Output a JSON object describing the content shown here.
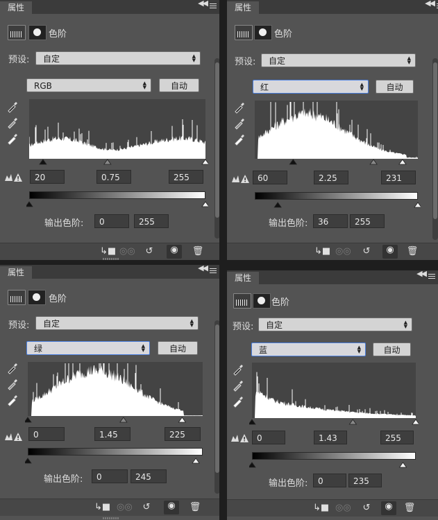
{
  "panels": [
    {
      "id": "rgb",
      "tab": "属性",
      "title": "色阶",
      "preset_label": "预设:",
      "preset_value": "自定",
      "channel": "RGB",
      "auto_label": "自动",
      "input_black": "20",
      "input_gamma": "0.75",
      "input_white": "255",
      "output_label": "输出色阶:",
      "output_black": "0",
      "output_white": "255",
      "histogram_shape": "flat-rgb",
      "input_levels": {
        "black": 20,
        "gamma": 0.75,
        "white": 255
      },
      "output_levels": {
        "black": 0,
        "white": 255
      }
    },
    {
      "id": "red",
      "tab": "属性",
      "title": "色阶",
      "preset_label": "预设:",
      "preset_value": "自定",
      "channel": "红",
      "auto_label": "自动",
      "input_black": "60",
      "input_gamma": "2.25",
      "input_white": "231",
      "output_label": "输出色阶:",
      "output_black": "36",
      "output_white": "255",
      "histogram_shape": "hump-red",
      "input_levels": {
        "black": 60,
        "gamma": 2.25,
        "white": 231
      },
      "output_levels": {
        "black": 36,
        "white": 255
      }
    },
    {
      "id": "green",
      "tab": "属性",
      "title": "色阶",
      "preset_label": "预设:",
      "preset_value": "自定",
      "channel": "绿",
      "auto_label": "自动",
      "input_black": "0",
      "input_gamma": "1.45",
      "input_white": "225",
      "output_label": "输出色阶:",
      "output_black": "0",
      "output_white": "245",
      "histogram_shape": "hump-green",
      "input_levels": {
        "black": 0,
        "gamma": 1.45,
        "white": 225
      },
      "output_levels": {
        "black": 0,
        "white": 245
      }
    },
    {
      "id": "blue",
      "tab": "属性",
      "title": "色阶",
      "preset_label": "预设:",
      "preset_value": "自定",
      "channel": "蓝",
      "auto_label": "自动",
      "input_black": "0",
      "input_gamma": "1.43",
      "input_white": "255",
      "output_label": "输出色阶:",
      "output_black": "0",
      "output_white": "235",
      "histogram_shape": "decay-blue",
      "input_levels": {
        "black": 0,
        "gamma": 1.43,
        "white": 255
      },
      "output_levels": {
        "black": 0,
        "white": 235
      }
    }
  ],
  "icons": {
    "levels_icon": "histogram-icon",
    "mask_icon": "mask-icon",
    "eyedroppers": [
      "black-point-eyedropper-icon",
      "gray-point-eyedropper-icon",
      "white-point-eyedropper-icon"
    ],
    "clip_warning": "clipping-warning-icon",
    "bottom": [
      "clip-to-layer-icon",
      "view-previous-state-icon",
      "reset-icon",
      "visibility-eye-icon",
      "delete-icon"
    ]
  },
  "colors": {
    "panel_bg": "#535353",
    "tabbar_bg": "#3b3b3b",
    "histogram_bg": "#444444",
    "histogram_fill": "#ffffff",
    "focus_border": "#4a7fe0"
  }
}
